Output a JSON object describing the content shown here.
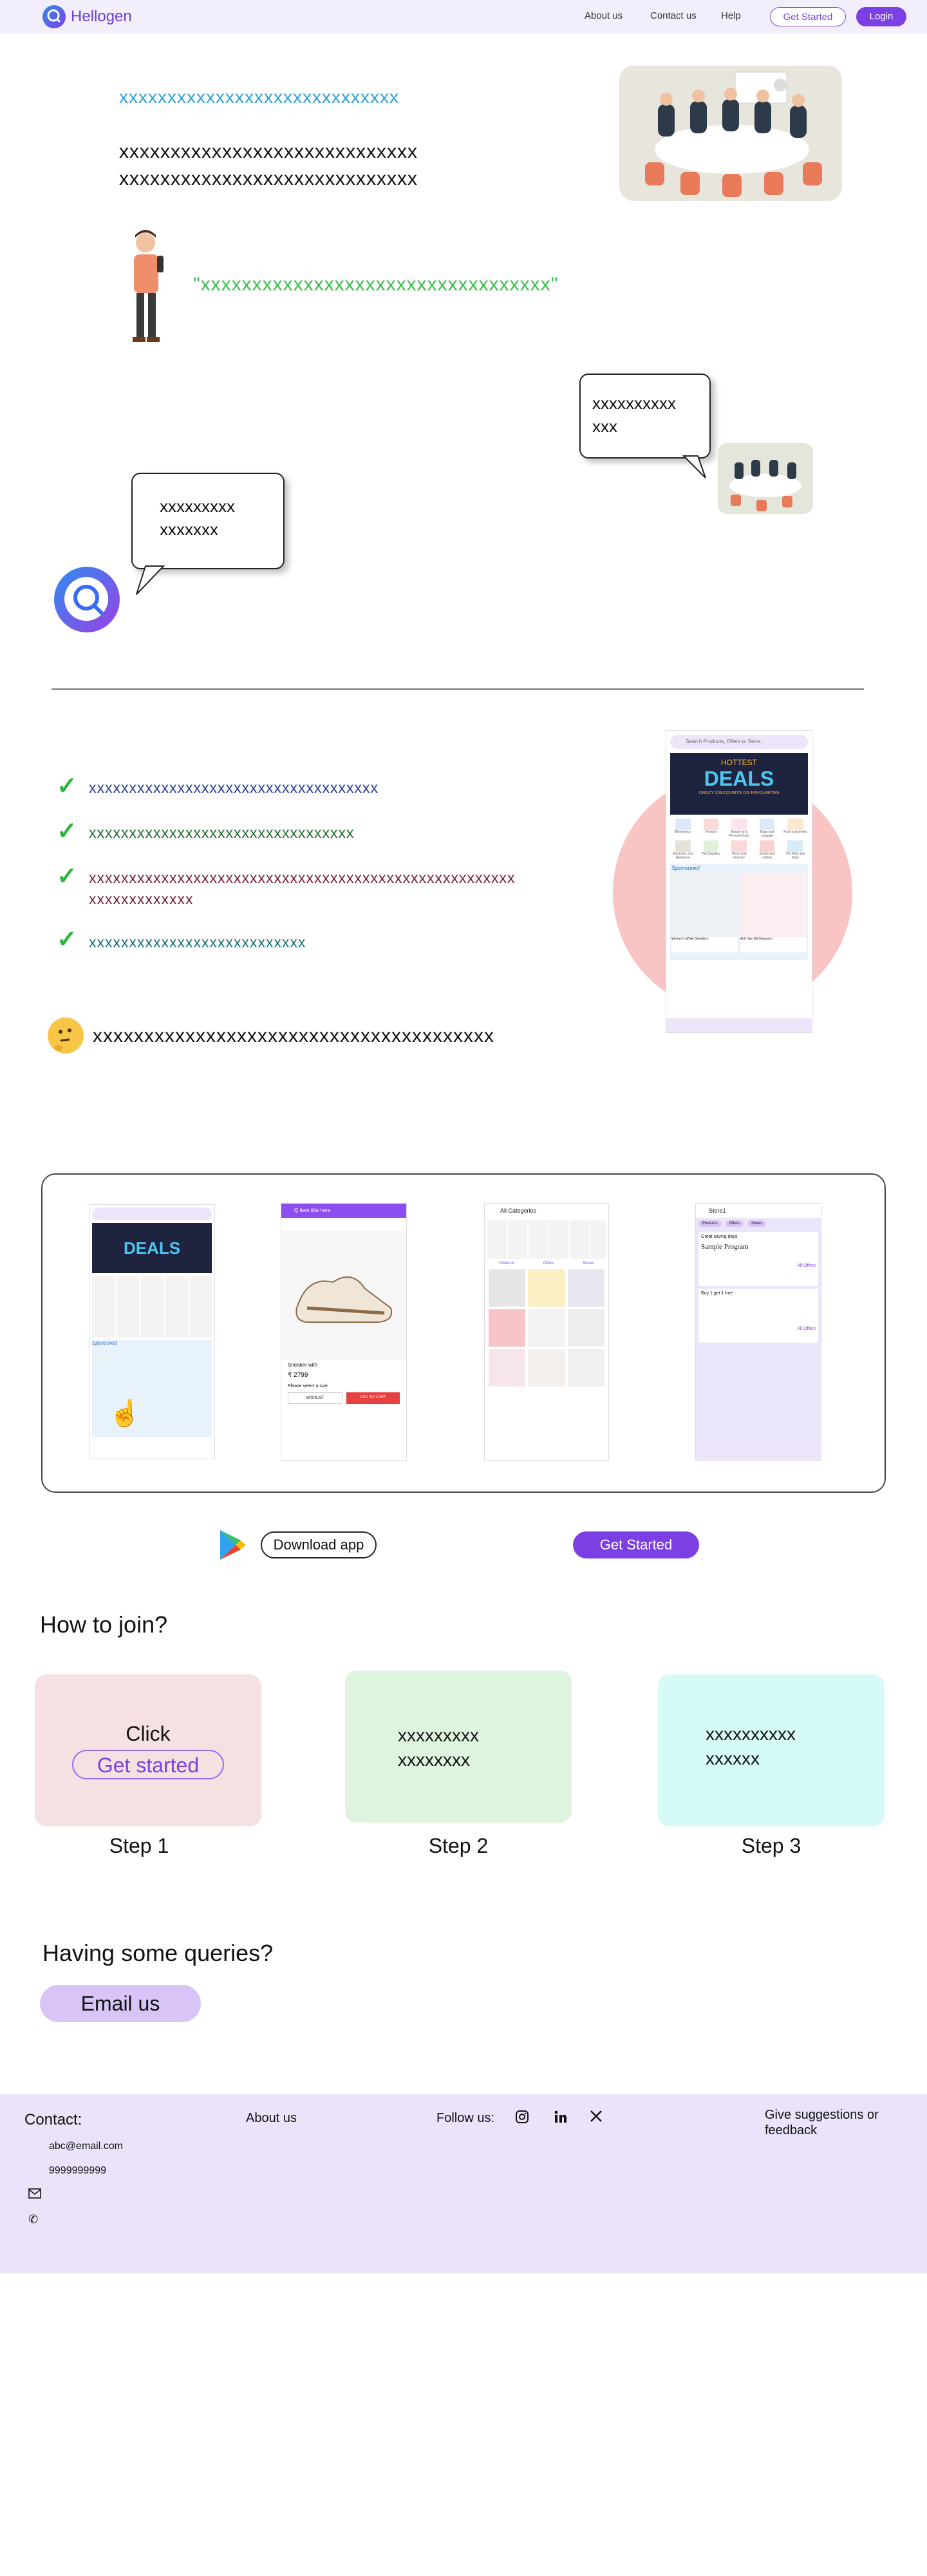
{
  "header": {
    "logo_text": "Hellogen",
    "nav": [
      "About us",
      "Contact us",
      "Help"
    ],
    "get_started": "Get Started",
    "login": "Login"
  },
  "hero": {
    "blue_line": "xxxxxxxxxxxxxxxxxxxxxxxxxxxxx",
    "black_line_1": "xxxxxxxxxxxxxxxxxxxxxxxxxxxxx",
    "black_line_2": "xxxxxxxxxxxxxxxxxxxxxxxxxxxxx",
    "quote": "\"xxxxxxxxxxxxxxxxxxxxxxxxxxxxxxxxxx\""
  },
  "bubbles": {
    "right_line_1": "xxxxxxxxxx",
    "right_line_2": "xxx",
    "left_line_1": "xxxxxxxxx",
    "left_line_2": "xxxxxxx"
  },
  "features": {
    "items": [
      {
        "text": "xxxxxxxxxxxxxxxxxxxxxxxxxxxxxxxxxxxx",
        "color": "#243a9c"
      },
      {
        "text": "xxxxxxxxxxxxxxxxxxxxxxxxxxxxxxxxx",
        "color": "#1f6b33"
      },
      {
        "text": "xxxxxxxxxxxxxxxxxxxxxxxxxxxxxxxxxxxxxxxxxxxxxxxxxxxxx",
        "text2": "xxxxxxxxxxxxx",
        "color": "#7a1d3a"
      },
      {
        "text": "xxxxxxxxxxxxxxxxxxxxxxxxxxx",
        "color": "#16707a"
      }
    ],
    "thinking_text": "xxxxxxxxxxxxxxxxxxxxxxxxxxxxxxxxxxxxxxx"
  },
  "phone_main": {
    "search_placeholder": "Search Products, Offers or Store...",
    "banner_title": "DEALS",
    "banner_kicker": "HOTTEST",
    "banner_sub": "CRAZY DISCOUNTS ON FAVOURITES",
    "categories": [
      "Electronics",
      "Vehicles",
      "Beauty and Personal Care",
      "Bags and Luggage",
      "Food and drinks",
      "Electronic and Appliance",
      "Pet Supplies",
      "Home and Grocery",
      "Sports and outdoor",
      "The Kids and Baby"
    ],
    "sponsored": "Sponsored",
    "product_1": "Women's White Sneakers",
    "product_2": "Anti Hair fall Shampoo"
  },
  "shots": {
    "shot2_header": "Q  item title here",
    "shot2_product": "Sneaker with",
    "shot2_price": "₹ 2799",
    "shot2_select": "Please select a size",
    "shot2_wishlist": "WISHLIST",
    "shot2_add": "ADD TO CART",
    "shot3_title": "All Categories",
    "shot3_tabs": [
      "Products",
      "Offers",
      "Stores"
    ],
    "shot4_title": "Store1",
    "shot4_tabs": [
      "Products",
      "Offers",
      "Stores"
    ],
    "shot4_deal_1": "Great saving days",
    "shot4_program": "Sample Program",
    "shot4_deal_2": "Buy 1 get 1 free",
    "shot4_all_offers": "All Offers"
  },
  "cta": {
    "download": "Download app",
    "get_started": "Get Started"
  },
  "join": {
    "title": "How to join?",
    "step1_click": "Click",
    "step1_button": "Get started",
    "step2_text_1": "xxxxxxxxx",
    "step2_text_2": "xxxxxxxx",
    "step3_text_1": "xxxxxxxxxx",
    "step3_text_2": "xxxxxx",
    "labels": [
      "Step 1",
      "Step 2",
      "Step 3"
    ],
    "colors": [
      "#f5e1e1",
      "#dff4df",
      "#d6faf6"
    ]
  },
  "queries": {
    "title": "Having some queries?",
    "email_button": "Email us"
  },
  "footer": {
    "contact_title": "Contact:",
    "email": "abc@email.com",
    "phone": "9999999999",
    "about": "About us",
    "follow": "Follow us:",
    "feedback_1": "Give suggestions or",
    "feedback_2": "feedback"
  }
}
